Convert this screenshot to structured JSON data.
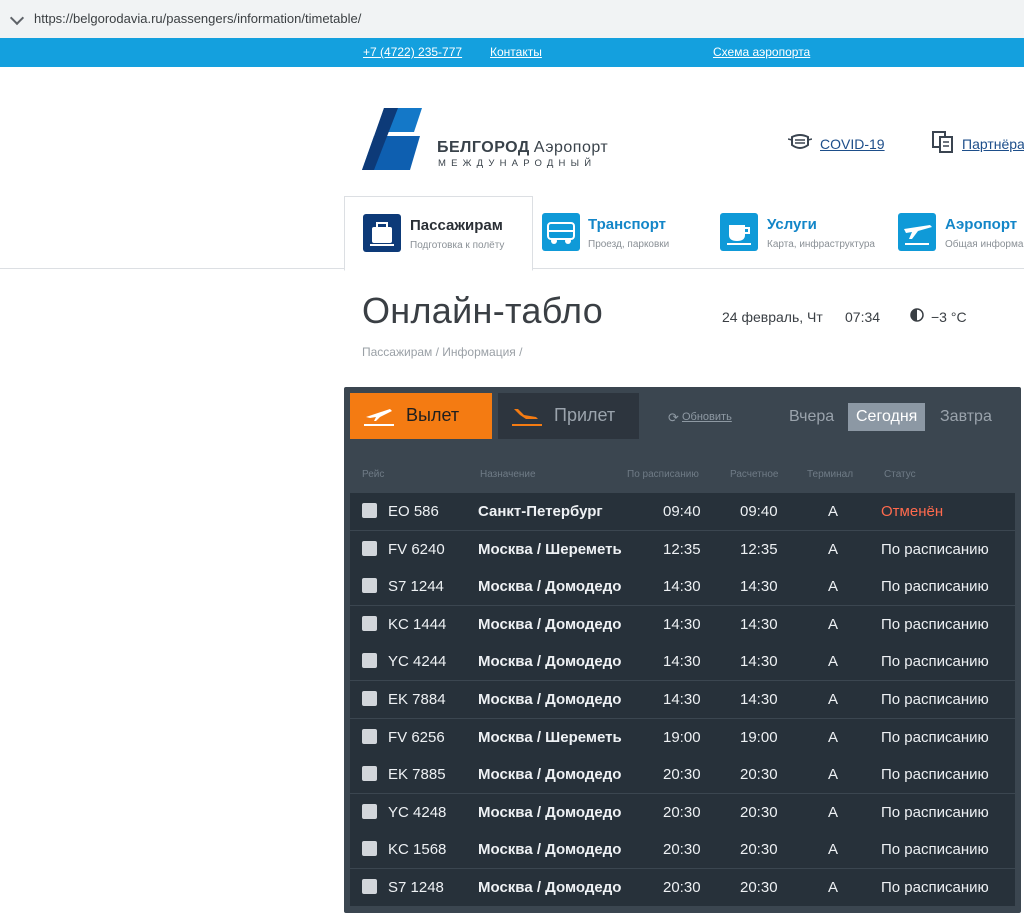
{
  "browser": {
    "url": "https://belgorodavia.ru/passengers/information/timetable/"
  },
  "top_bar": {
    "phone": "+7 (4722) 235-777",
    "contacts": "Контакты",
    "scheme": "Схема аэропорта"
  },
  "brand": {
    "name_bold": "БЕЛГОРОД",
    "name_regular": "Аэропорт",
    "subtitle": "МЕЖДУНАРОДНЫЙ"
  },
  "header_links": {
    "covid": "COVID-19",
    "partners": "Партнёра"
  },
  "nav": [
    {
      "title": "Пассажирам",
      "sub": "Подготовка к полёту",
      "icon": "suitcase-icon"
    },
    {
      "title": "Транспорт",
      "sub": "Проезд, парковки",
      "icon": "bus-icon"
    },
    {
      "title": "Услуги",
      "sub": "Карта, инфраструктура",
      "icon": "coffee-icon"
    },
    {
      "title": "Аэропорт",
      "sub": "Общая информа",
      "icon": "plane-icon"
    }
  ],
  "page": {
    "title": "Онлайн-табло",
    "date": "24 февраль, Чт",
    "time": "07:34",
    "weather": "−3 °C",
    "breadcrumb": "Пассажирам / Информация /"
  },
  "board": {
    "tabs": {
      "departure": "Вылет",
      "arrival": "Прилет"
    },
    "refresh": "Обновить",
    "days": {
      "yesterday": "Вчера",
      "today": "Сегодня",
      "tomorrow": "Завтра"
    },
    "columns": {
      "flight": "Рейс",
      "destination": "Назначение",
      "scheduled": "По расписанию",
      "estimated": "Расчетное",
      "terminal": "Терминал",
      "status": "Статус"
    },
    "rows": [
      {
        "flight": "EO 586",
        "destination": "Санкт-Петербург",
        "scheduled": "09:40",
        "estimated": "09:40",
        "terminal": "A",
        "status": "Отменён"
      },
      {
        "flight": "FV 6240",
        "destination": "Москва / Шереметь",
        "scheduled": "12:35",
        "estimated": "12:35",
        "terminal": "A",
        "status": "По расписанию"
      },
      {
        "flight": "S7 1244",
        "destination": "Москва / Домодедо",
        "scheduled": "14:30",
        "estimated": "14:30",
        "terminal": "A",
        "status": "По расписанию"
      },
      {
        "flight": "KC 1444",
        "destination": "Москва / Домодедо",
        "scheduled": "14:30",
        "estimated": "14:30",
        "terminal": "A",
        "status": "По расписанию"
      },
      {
        "flight": "YC 4244",
        "destination": "Москва / Домодедо",
        "scheduled": "14:30",
        "estimated": "14:30",
        "terminal": "A",
        "status": "По расписанию"
      },
      {
        "flight": "EK 7884",
        "destination": "Москва / Домодедо",
        "scheduled": "14:30",
        "estimated": "14:30",
        "terminal": "A",
        "status": "По расписанию"
      },
      {
        "flight": "FV 6256",
        "destination": "Москва / Шереметь",
        "scheduled": "19:00",
        "estimated": "19:00",
        "terminal": "A",
        "status": "По расписанию"
      },
      {
        "flight": "EK 7885",
        "destination": "Москва / Домодедо",
        "scheduled": "20:30",
        "estimated": "20:30",
        "terminal": "A",
        "status": "По расписанию"
      },
      {
        "flight": "YC 4248",
        "destination": "Москва / Домодедо",
        "scheduled": "20:30",
        "estimated": "20:30",
        "terminal": "A",
        "status": "По расписанию"
      },
      {
        "flight": "KC 1568",
        "destination": "Москва / Домодедо",
        "scheduled": "20:30",
        "estimated": "20:30",
        "terminal": "A",
        "status": "По расписанию"
      },
      {
        "flight": "S7 1248",
        "destination": "Москва / Домодедо",
        "scheduled": "20:30",
        "estimated": "20:30",
        "terminal": "A",
        "status": "По расписанию"
      }
    ]
  },
  "colors": {
    "brand_blue": "#14a0de",
    "departure_orange": "#f47b12",
    "cancel_red": "#ff6a4d",
    "board_bg": "#3b4650"
  }
}
